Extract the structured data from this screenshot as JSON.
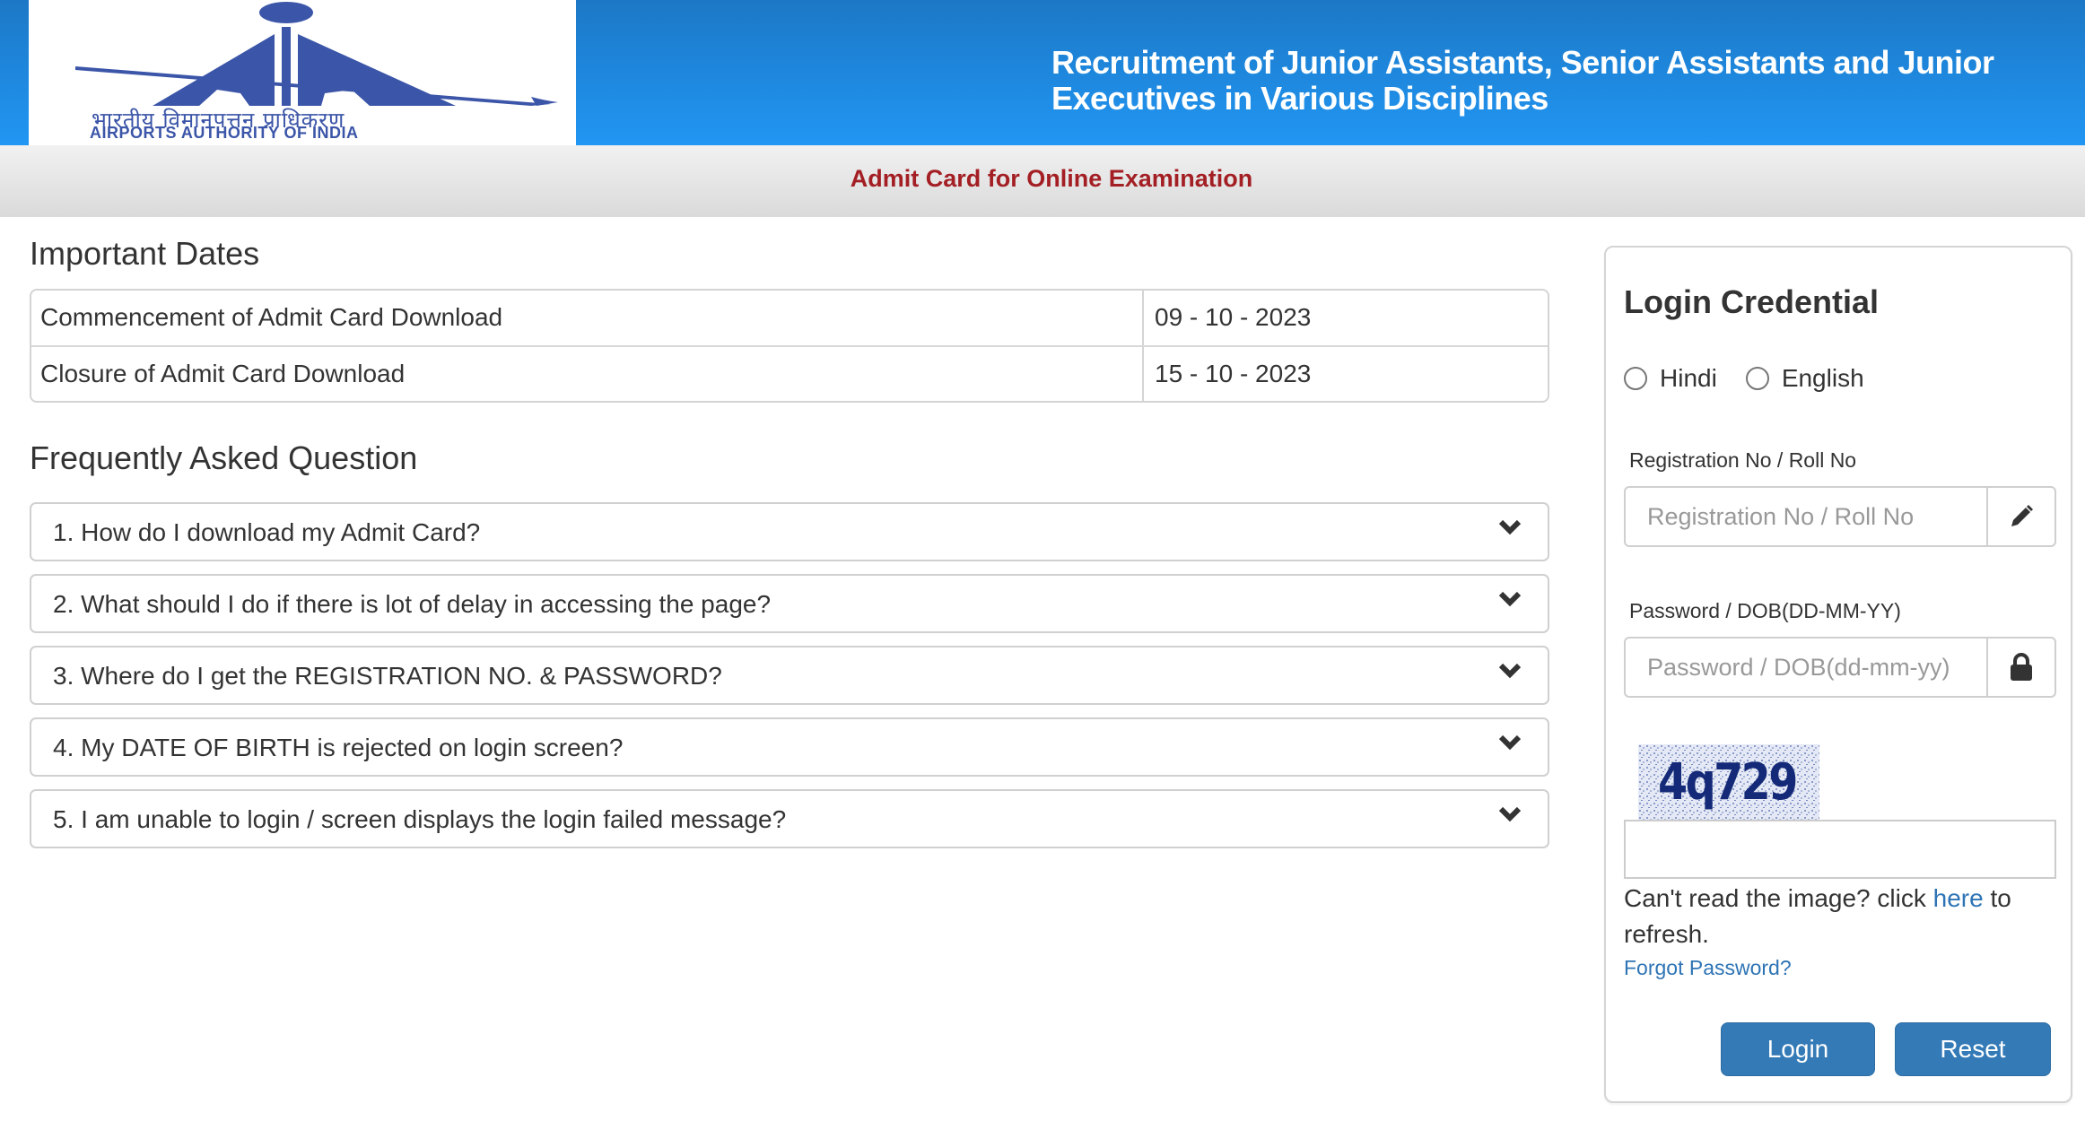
{
  "header": {
    "logo": {
      "hindi_text": "भारतीय विमानपत्तन प्राधिकरण",
      "english_text": "AIRPORTS AUTHORITY OF INDIA",
      "brand_color": "#3b55a8"
    },
    "title_line1": "Recruitment of Junior Assistants, Senior Assistants and Junior",
    "title_line2": "Executives in Various Disciplines"
  },
  "subbar": {
    "title": "Admit Card for Online Examination",
    "title_color": "#a31f24"
  },
  "important_dates": {
    "heading": "Important Dates",
    "rows": [
      {
        "label": "Commencement of Admit Card Download",
        "value": "09 - 10 - 2023"
      },
      {
        "label": "Closure of Admit Card Download",
        "value": "15 - 10 - 2023"
      }
    ]
  },
  "faq": {
    "heading": "Frequently Asked Question",
    "items": [
      {
        "question": "1. How do I download my Admit Card?",
        "icon": "chevron-down-icon"
      },
      {
        "question": "2. What should I do if there is lot of delay in accessing the page?",
        "icon": "chevron-down-icon"
      },
      {
        "question": "3. Where do I get the REGISTRATION NO. & PASSWORD?",
        "icon": "chevron-down-icon"
      },
      {
        "question": "4. My DATE OF BIRTH is rejected on login screen?",
        "icon": "chevron-down-icon"
      },
      {
        "question": "5. I am unable to login / screen displays the login failed message?",
        "icon": "chevron-down-icon"
      }
    ]
  },
  "login": {
    "title": "Login Credential",
    "language_options": [
      {
        "label": "Hindi",
        "selected": false
      },
      {
        "label": "English",
        "selected": false
      }
    ],
    "registration": {
      "label": "Registration No / Roll No",
      "placeholder": "Registration No / Roll No",
      "value": "",
      "icon": "pencil-icon"
    },
    "password": {
      "label": "Password / DOB(DD-MM-YY)",
      "placeholder": "Password / DOB(dd-mm-yy)",
      "value": "",
      "icon": "lock-icon"
    },
    "captcha": {
      "image_text": "4q729",
      "input_value": "",
      "help_prefix": "Can't read the image? click ",
      "help_link": "here",
      "help_suffix": " to refresh."
    },
    "forgot_password": "Forgot Password?",
    "login_button": "Login",
    "reset_button": "Reset",
    "button_color": "#337ab7",
    "link_color": "#2e74b5"
  }
}
